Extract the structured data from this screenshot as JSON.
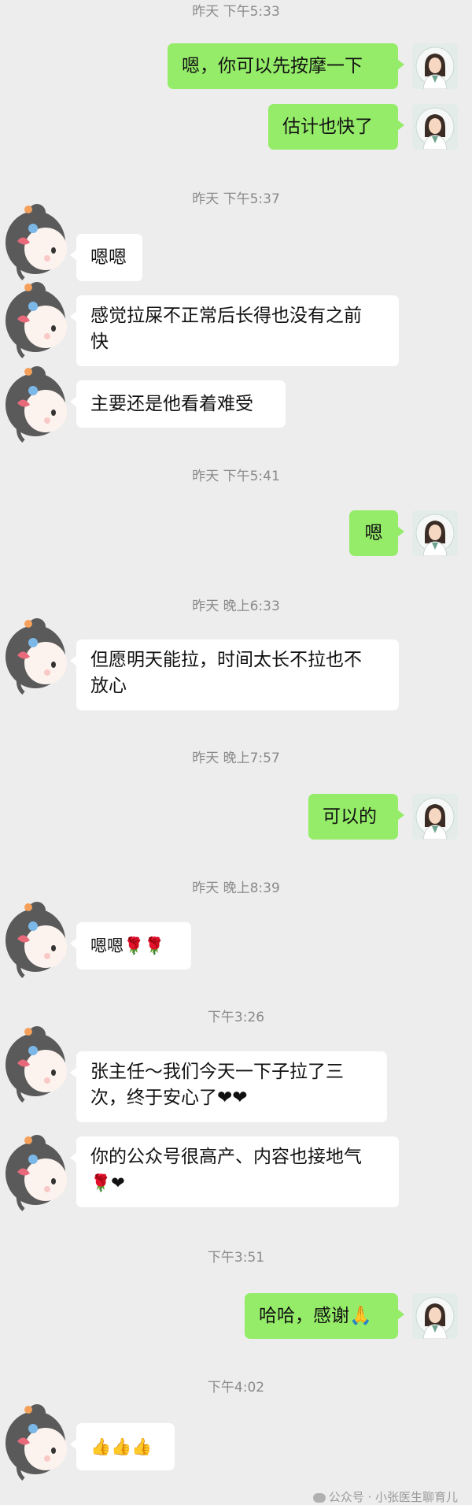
{
  "timestamps": {
    "t1": "昨天 下午5:33",
    "t2": "昨天 下午5:37",
    "t3": "昨天 下午5:41",
    "t4": "昨天 晚上6:33",
    "t5": "昨天 晚上7:57",
    "t6": "昨天 晚上8:39",
    "t7": "下午3:26",
    "t8": "下午3:51",
    "t9": "下午4:02"
  },
  "messages": {
    "m1": "嗯，你可以先按摩一下",
    "m2": "估计也快了",
    "m3": "嗯嗯",
    "m4a": "感觉拉屎不正常后长得也没有之前",
    "m4b": "快",
    "m5": "主要还是他看着难受",
    "m6": "嗯",
    "m7a": "但愿明天能拉，时间太长不拉也不",
    "m7b": "放心",
    "m8": "可以的",
    "m9": "嗯嗯🌹🌹",
    "m10a": "张主任～我们今天一下子拉了三",
    "m10b": "次，终于安心了❤❤",
    "m11a": "你的公众号很高产、内容也接地气",
    "m11b": "🌹❤",
    "m12": "哈哈，感谢🙏",
    "m13": "👍👍👍"
  },
  "watermark": "公众号 · 小张医生聊育儿",
  "colors": {
    "sent_bubble": "#95ec69",
    "received_bubble": "#ffffff",
    "background": "#ededed"
  }
}
